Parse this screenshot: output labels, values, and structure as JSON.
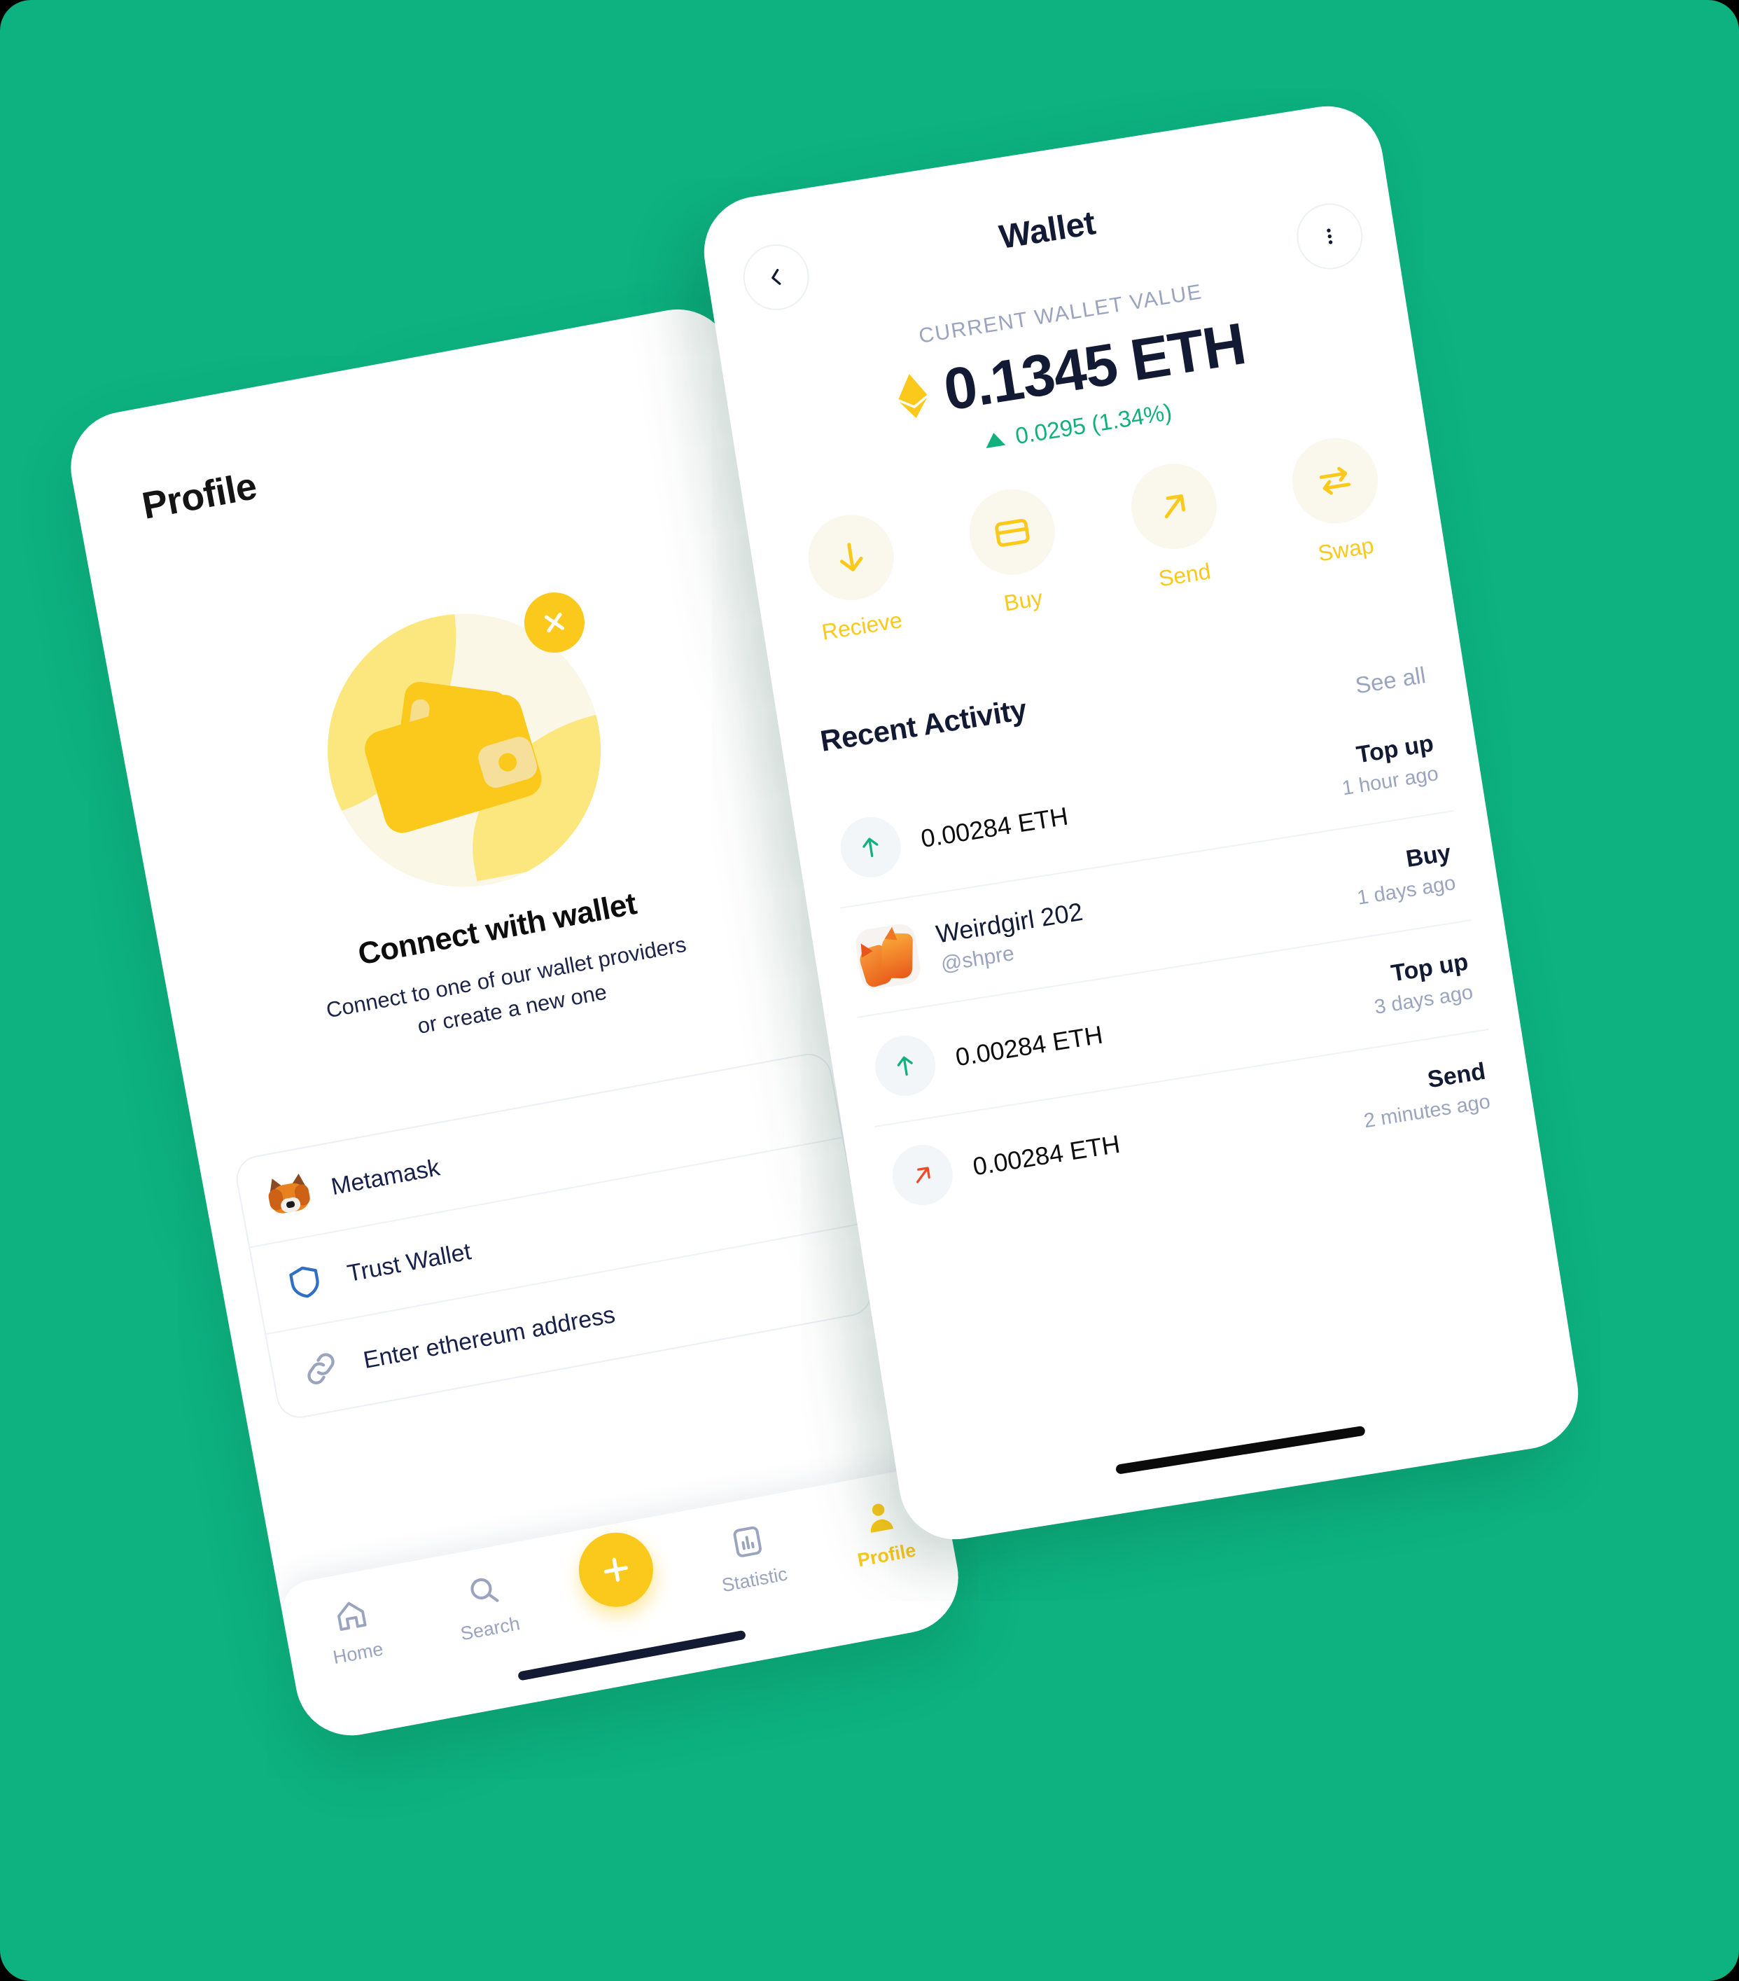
{
  "theme": {
    "background": "#0DB280",
    "accent_yellow": "#FBC91B",
    "text_dark": "#131a34",
    "text_muted": "#9aa4bf",
    "positive_green": "#11B07C",
    "negative_red": "#F04A28"
  },
  "profile_screen": {
    "title": "Profile",
    "illustration": {
      "name": "wallet-illustration",
      "badge_icon": "close-icon"
    },
    "heading": "Connect with wallet",
    "subtitle_line1": "Connect to one of our wallet providers",
    "subtitle_line2": "or create a new one",
    "providers": [
      {
        "label": "Metamask",
        "icon": "metamask-fox-icon"
      },
      {
        "label": "Trust Wallet",
        "icon": "shield-icon"
      },
      {
        "label": "Enter ethereum address",
        "icon": "link-icon"
      }
    ],
    "bottom_nav": {
      "items": [
        {
          "label": "Home",
          "icon": "home-icon",
          "active": false
        },
        {
          "label": "Search",
          "icon": "search-icon",
          "active": false
        },
        {
          "label": "",
          "icon": "plus-icon",
          "active": false,
          "fab": true
        },
        {
          "label": "Statistic",
          "icon": "chart-icon",
          "active": false
        },
        {
          "label": "Profile",
          "icon": "person-icon",
          "active": true
        }
      ]
    }
  },
  "wallet_screen": {
    "back_icon": "chevron-left-icon",
    "menu_icon": "more-vertical-icon",
    "title": "Wallet",
    "value_label": "CURRENT WALLET VALUE",
    "amount": "0.1345 ETH",
    "currency_icon": "ethereum-icon",
    "delta": "0.0295 (1.34%)",
    "delta_direction": "up",
    "actions": [
      {
        "label": "Recieve",
        "icon": "arrow-down-icon"
      },
      {
        "label": "Buy",
        "icon": "credit-card-icon"
      },
      {
        "label": "Send",
        "icon": "arrow-up-right-icon"
      },
      {
        "label": "Swap",
        "icon": "swap-arrows-icon"
      }
    ],
    "recent_activity": {
      "heading": "Recent Activity",
      "see_all": "See all",
      "rows": [
        {
          "kind": "amount",
          "icon": "arrow-up-icon",
          "icon_color": "#11B07C",
          "amount": "0.00284 ETH",
          "type": "Top up",
          "time": "1 hour ago"
        },
        {
          "kind": "profile",
          "icon": "fox-avatar",
          "name": "Weirdgirl 202",
          "handle": "@shpre",
          "type": "Buy",
          "time": "1 days ago"
        },
        {
          "kind": "amount",
          "icon": "arrow-up-icon",
          "icon_color": "#11B07C",
          "amount": "0.00284 ETH",
          "type": "Top up",
          "time": "3 days ago"
        },
        {
          "kind": "amount",
          "icon": "arrow-up-right-icon",
          "icon_color": "#F04A28",
          "amount": "0.00284 ETH",
          "type": "Send",
          "time": "2 minutes ago"
        }
      ]
    }
  }
}
